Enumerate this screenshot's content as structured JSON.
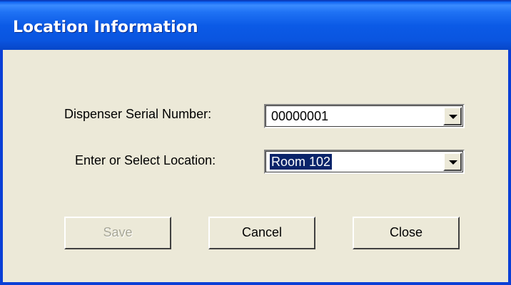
{
  "window": {
    "title": "Location Information"
  },
  "form": {
    "serial_label": "Dispenser Serial Number:",
    "serial_value": "00000001",
    "location_label": "Enter or Select Location:",
    "location_value": "Room 102"
  },
  "buttons": {
    "save": {
      "label": "Save",
      "enabled": false
    },
    "cancel": {
      "label": "Cancel",
      "enabled": true
    },
    "close": {
      "label": "Close",
      "enabled": true
    }
  },
  "colors": {
    "titlebar": "#0a55e0",
    "dialog_bg": "#ece9d8",
    "selection": "#0a246a"
  },
  "icons": {
    "dropdown": "chevron-down-icon"
  }
}
